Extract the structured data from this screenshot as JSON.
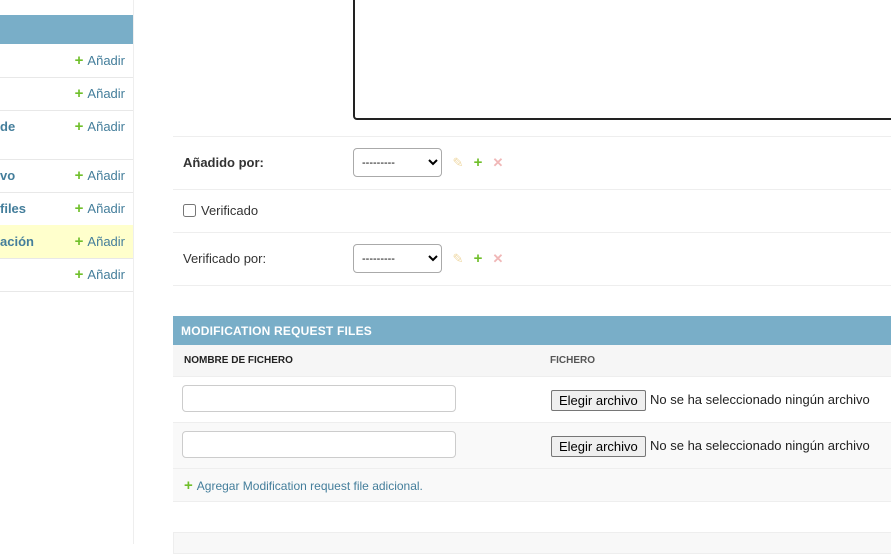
{
  "sidebar": {
    "add_label": "Añadir",
    "items": [
      {
        "name": ""
      },
      {
        "name": ""
      },
      {
        "name": "de"
      },
      {
        "name": "vo"
      },
      {
        "name": "files"
      },
      {
        "name": "ación"
      },
      {
        "name": ""
      }
    ]
  },
  "form": {
    "added_by": {
      "label": "Añadido por:",
      "value": "---------"
    },
    "verified": {
      "label": "Verificado",
      "checked": false
    },
    "verified_by": {
      "label": "Verificado por:",
      "value": "---------"
    }
  },
  "inline": {
    "title": "MODIFICATION REQUEST FILES",
    "columns": [
      "NOMBRE DE FICHERO",
      "FICHERO"
    ],
    "rows": [
      {
        "filename": "",
        "button_label": "Elegir archivo",
        "file_status": "No se ha seleccionado ningún archivo"
      },
      {
        "filename": "",
        "button_label": "Elegir archivo",
        "file_status": "No se ha seleccionado ningún archivo"
      }
    ],
    "add_another": "Agregar Modification request file adicional."
  }
}
